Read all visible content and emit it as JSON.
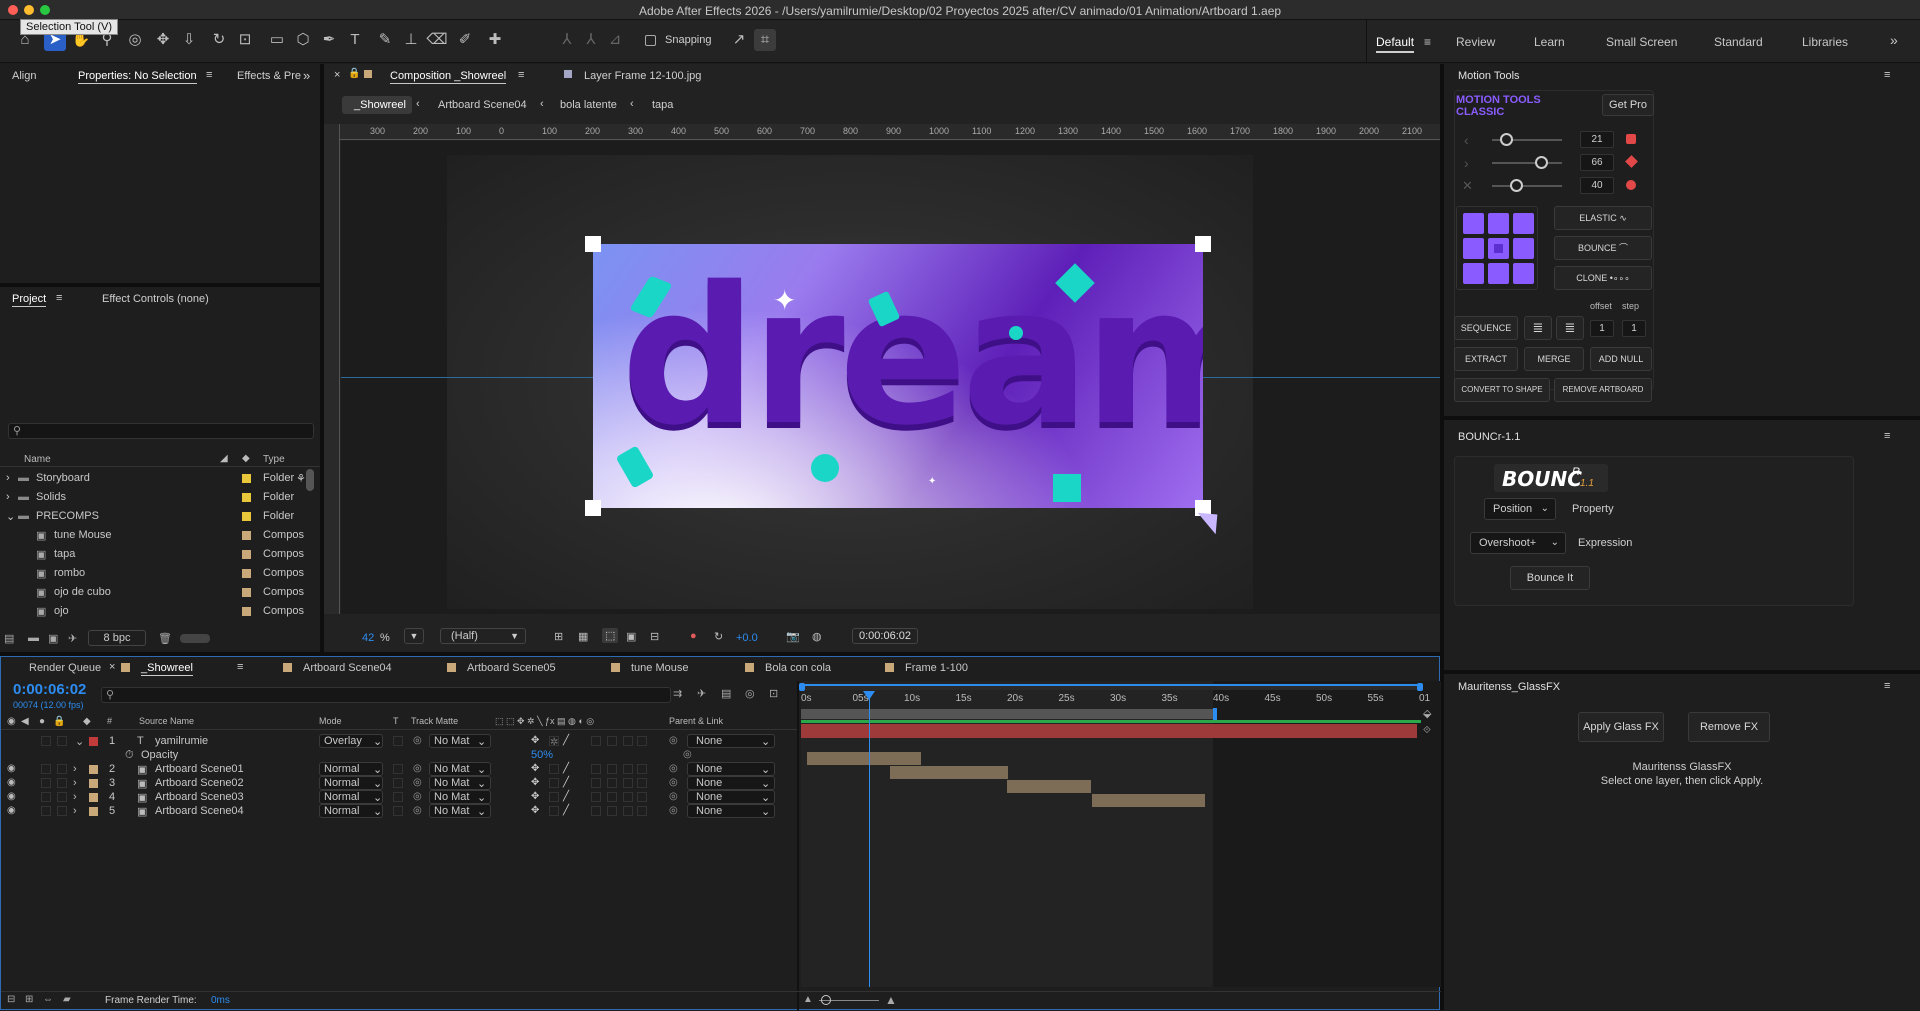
{
  "window": {
    "title": "Adobe After Effects 2026 - /Users/yamilrumie/Desktop/02 Proyectos 2025 after/CV animado/01 Animation/Artboard 1.aep"
  },
  "tooltip": "Selection Tool (V)",
  "toolbar": {
    "snapping": "Snapping",
    "workspaces": [
      "Default",
      "Review",
      "Learn",
      "Small Screen",
      "Standard",
      "Libraries"
    ]
  },
  "left_tabs": {
    "align": "Align",
    "properties": "Properties: No Selection",
    "effects": "Effects & Pre"
  },
  "project": {
    "tab": "Project",
    "effect_controls": "Effect Controls (none)",
    "col_name": "Name",
    "col_type": "Type",
    "items": [
      {
        "name": "Storyboard",
        "type": "Folder",
        "kind": "folder"
      },
      {
        "name": "Solids",
        "type": "Folder",
        "kind": "folder"
      },
      {
        "name": "PRECOMPS",
        "type": "Folder",
        "kind": "folder-open"
      },
      {
        "name": "tune Mouse",
        "type": "Compos",
        "kind": "comp"
      },
      {
        "name": "tapa",
        "type": "Compos",
        "kind": "comp"
      },
      {
        "name": "rombo",
        "type": "Compos",
        "kind": "comp"
      },
      {
        "name": "ojo de cubo",
        "type": "Compos",
        "kind": "comp"
      },
      {
        "name": "ojo",
        "type": "Compos",
        "kind": "comp"
      }
    ],
    "bpc": "8 bpc"
  },
  "composition": {
    "tab": "Composition _Showreel",
    "layer_tab": "Layer Frame 12-100.jpg",
    "breadcrumbs": [
      "_Showreel",
      "Artboard Scene04",
      "bola latente",
      "tapa"
    ],
    "ruler": [
      "300",
      "200",
      "100",
      "0",
      "100",
      "200",
      "300",
      "400",
      "500",
      "600",
      "700",
      "800",
      "900",
      "1000",
      "1100",
      "1200",
      "1300",
      "1400",
      "1500",
      "1600",
      "1700",
      "1800",
      "1900",
      "2000",
      "2100",
      "2200"
    ],
    "artwork_text": "dream",
    "zoom": "42",
    "zoom_unit": "%",
    "resolution": "(Half)",
    "exposure": "+0.0",
    "timecode": "0:00:06:02"
  },
  "timeline": {
    "tabs": [
      "Render Queue",
      "_Showreel",
      "Artboard Scene04",
      "Artboard Scene05",
      "tune Mouse",
      "Bola con cola",
      "Frame 1-100"
    ],
    "timecode": "0:00:06:02",
    "fps": "00074 (12.00 fps)",
    "headers": {
      "num": "#",
      "source": "Source Name",
      "mode": "Mode",
      "t": "T",
      "matte": "Track Matte",
      "parent": "Parent & Link"
    },
    "ticks": [
      "0s",
      "05s",
      "10s",
      "15s",
      "20s",
      "25s",
      "30s",
      "35s",
      "40s",
      "45s",
      "50s",
      "55s",
      "01"
    ],
    "layers": [
      {
        "num": "1",
        "name": "yamilrumie",
        "mode": "Overlay",
        "matte": "No Mat",
        "parent": "None",
        "label": "#c23b3b"
      },
      {
        "num": "2",
        "name": "Artboard Scene01",
        "mode": "Normal",
        "matte": "No Mat",
        "parent": "None",
        "label": "#c9a87a"
      },
      {
        "num": "3",
        "name": "Artboard Scene02",
        "mode": "Normal",
        "matte": "No Mat",
        "parent": "None",
        "label": "#c9a87a"
      },
      {
        "num": "4",
        "name": "Artboard Scene03",
        "mode": "Normal",
        "matte": "No Mat",
        "parent": "None",
        "label": "#c9a87a"
      },
      {
        "num": "5",
        "name": "Artboard Scene04",
        "mode": "Normal",
        "matte": "No Mat",
        "parent": "None",
        "label": "#c9a87a"
      }
    ],
    "opacity_label": "Opacity",
    "opacity_value": "50%",
    "render_time_label": "Frame Render Time:",
    "render_time": "0ms"
  },
  "motion_tools": {
    "panel": "Motion Tools",
    "brand1": "MOTION TOOLS",
    "brand2": "CLASSIC",
    "get_pro": "Get Pro",
    "sliders": [
      "21",
      "66",
      "40"
    ],
    "elastic": "ELASTIC",
    "bounce": "BOUNCE",
    "clone": "CLONE",
    "offset": "offset",
    "step": "step",
    "sequence": "SEQUENCE",
    "offset_val": "1",
    "step_val": "1",
    "extract": "EXTRACT",
    "merge": "MERGE",
    "add_null": "ADD NULL",
    "convert": "CONVERT TO SHAPE",
    "remove_artboard": "REMOVE ARTBOARD"
  },
  "bouncr": {
    "panel": "BOUNCr-1.1",
    "logo": "BOUNC",
    "logo_sup": "R",
    "logo_ver": "1.1",
    "property_value": "Position",
    "property_label": "Property",
    "expression_value": "Overshoot+",
    "expression_label": "Expression",
    "button": "Bounce It"
  },
  "glass": {
    "panel": "Mauritenss_GlassFX",
    "apply": "Apply Glass FX",
    "remove": "Remove FX",
    "name": "Mauritenss GlassFX",
    "hint": "Select one layer, then click Apply."
  },
  "colors": {
    "accent": "#2d8cf0",
    "purple": "#8a5cff",
    "teal": "#19d6c7",
    "layer_red": "#9e3a3a"
  }
}
